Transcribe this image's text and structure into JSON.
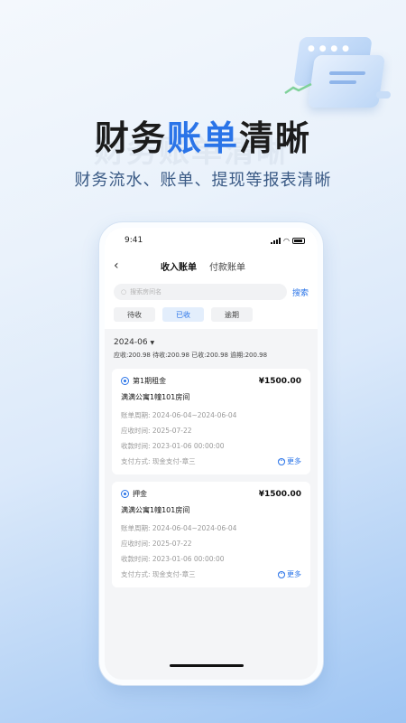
{
  "headline": {
    "part1": "财务",
    "accent": "账单",
    "part2": "清晰",
    "subtitle": "财务流水、账单、提现等报表清晰"
  },
  "phone": {
    "status_time": "9:41",
    "nav": {
      "tabs": [
        {
          "label": "收入账单",
          "active": true
        },
        {
          "label": "付款账单",
          "active": false
        }
      ]
    },
    "search": {
      "placeholder": "搜索房间名",
      "button_label": "搜索"
    },
    "filters": [
      {
        "label": "待收",
        "active": false
      },
      {
        "label": "已收",
        "active": true
      },
      {
        "label": "逾期",
        "active": false
      }
    ],
    "month_label": "2024-06",
    "summary": "应收:200.98  待收:200.98  已收:200.98  逾期:200.98",
    "bills": [
      {
        "title": "第1期租金",
        "amount": "¥1500.00",
        "room": "满满公寓1幢101房间",
        "period": "账单周期:  2024-06-04~2024-06-04",
        "due": "应收时间:  2025-07-22",
        "received": "收款时间:  2023-01-06 00:00:00",
        "payment": "支付方式:  现金支付-章三",
        "more_label": "更多"
      },
      {
        "title": "押金",
        "amount": "¥1500.00",
        "room": "满满公寓1幢101房间",
        "period": "账单周期:  2024-06-04~2024-06-04",
        "due": "应收时间:  2025-07-22",
        "received": "收款时间:  2023-01-06 00:00:00",
        "payment": "支付方式:  现金支付-章三",
        "more_label": "更多"
      }
    ]
  },
  "colors": {
    "accent": "#2a74e8",
    "headline": "#1c1c1c",
    "subtitle": "#3a5a85"
  }
}
